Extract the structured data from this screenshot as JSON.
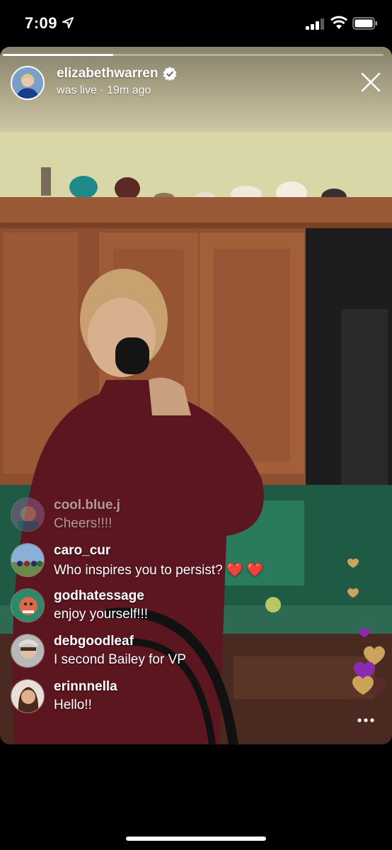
{
  "status_bar": {
    "time": "7:09",
    "icons": [
      "location-arrow-icon",
      "cellular-signal-icon",
      "wifi-icon",
      "battery-icon"
    ]
  },
  "live": {
    "host_username": "elizabethwarren",
    "verified": true,
    "status": "was live · 19m ago",
    "progress_fraction": 0.29,
    "close_icon": "close-icon"
  },
  "comments": [
    {
      "username": "cool.blue.j",
      "text": "Cheers!!!!"
    },
    {
      "username": "caro_cur",
      "text": "Who inspires you to persist? ❤️ ❤️"
    },
    {
      "username": "godhatessage",
      "text": "enjoy yourself!!!"
    },
    {
      "username": "debgoodleaf",
      "text": "I second Bailey for VP"
    },
    {
      "username": "erinnnella",
      "text": "Hello!!"
    }
  ],
  "more_icon": "more-horizontal-icon",
  "colors": {
    "heart_gold": "#c9a45a",
    "heart_purple": "#8a2bb0",
    "accent_white": "#ffffff"
  }
}
